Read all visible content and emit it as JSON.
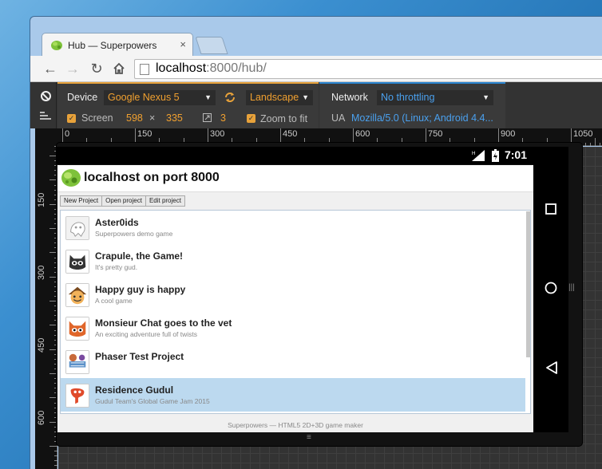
{
  "browser": {
    "tab_title": "Hub — Superpowers",
    "tab_close": "×",
    "url_host": "localhost",
    "url_path": ":8000/hub/"
  },
  "emulation": {
    "device_label": "Device",
    "device_value": "Google Nexus 5",
    "orientation_value": "Landscape",
    "screen_label": "Screen",
    "screen_width": "598",
    "screen_times": "×",
    "screen_height": "335",
    "dpr": "3",
    "zoom_label": "Zoom to fit",
    "network_label": "Network",
    "network_value": "No throttling",
    "ua_label": "UA",
    "ua_value": "Mozilla/5.0 (Linux; Android 4.4..."
  },
  "ruler": {
    "top": [
      "0",
      "150",
      "300",
      "450",
      "600",
      "750",
      "900",
      "1050"
    ],
    "left": [
      "150",
      "300",
      "450",
      "600"
    ]
  },
  "phone": {
    "time": "7:01"
  },
  "hub": {
    "title": "localhost on port 8000",
    "buttons": [
      "New Project",
      "Open project",
      "Edit project"
    ],
    "projects": [
      {
        "name": "Aster0ids",
        "description": "Superpowers demo game",
        "selected": false
      },
      {
        "name": "Crapule, the Game!",
        "description": "It's pretty gud.",
        "selected": false
      },
      {
        "name": "Happy guy is happy",
        "description": "A cool game",
        "selected": false
      },
      {
        "name": "Monsieur Chat goes to the vet",
        "description": "An exciting adventure full of twists",
        "selected": false
      },
      {
        "name": "Phaser Test Project",
        "description": "",
        "selected": false
      },
      {
        "name": "Residence Gudul",
        "description": "Gudul Team's Global Game Jam 2015",
        "selected": true
      }
    ],
    "footer": "Superpowers — HTML5 2D+3D game maker"
  },
  "colors": {
    "device_accent": "#e8a23a",
    "network_accent": "#2a85d0",
    "selected_row": "#bcd9ef"
  }
}
